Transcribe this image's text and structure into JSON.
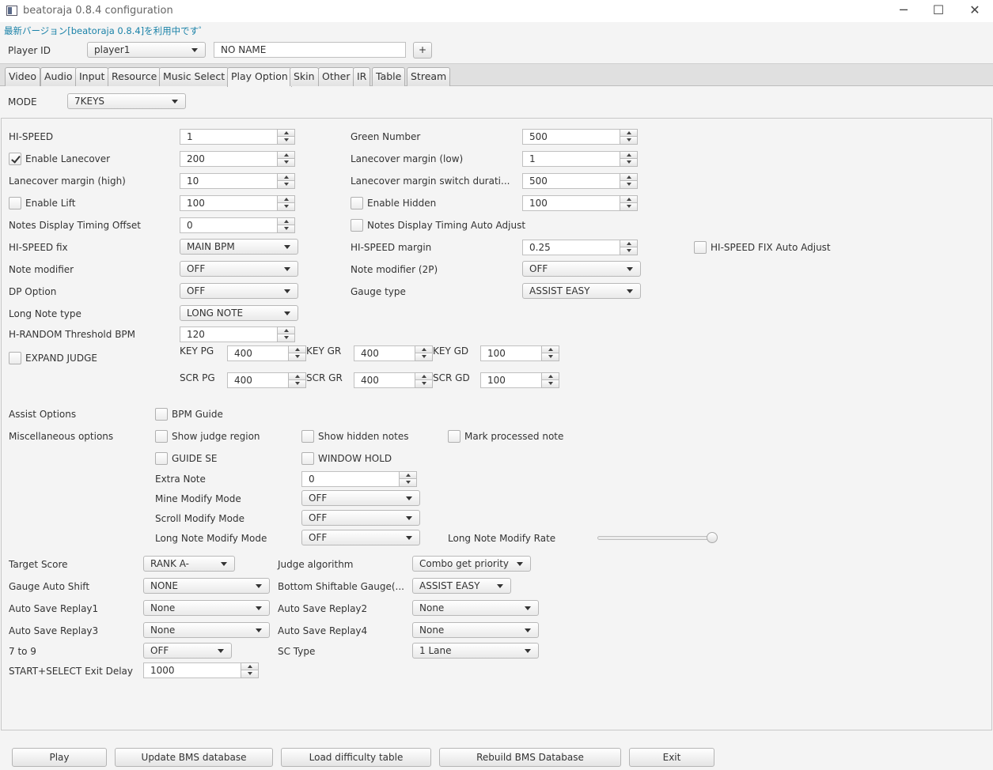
{
  "window": {
    "title": "beatoraja 0.8.4 configuration",
    "minimize_glyph": "─",
    "maximize_glyph": "☐",
    "close_glyph": "✕"
  },
  "update_message": "最新バージョン[beatoraja 0.8.4]を利用中です゜",
  "player": {
    "label": "Player ID",
    "selected": "player1",
    "name": "NO NAME",
    "add_label": "+"
  },
  "tabs": [
    {
      "label": "Video",
      "active": false
    },
    {
      "label": "Audio",
      "active": false
    },
    {
      "label": "Input",
      "active": false
    },
    {
      "label": "Resource",
      "active": false
    },
    {
      "label": "Music Select",
      "active": false
    },
    {
      "label": "Play Option",
      "active": true
    },
    {
      "label": "Skin",
      "active": false
    },
    {
      "label": "Other",
      "active": false
    },
    {
      "label": "IR",
      "active": false
    },
    {
      "label": "Table",
      "active": false
    },
    {
      "label": "Stream",
      "active": false
    }
  ],
  "mode": {
    "label": "MODE",
    "value": "7KEYS"
  },
  "options": {
    "hispeed": {
      "label": "HI-SPEED",
      "value": "1"
    },
    "green_number": {
      "label": "Green Number",
      "value": "500"
    },
    "enable_lanecover": {
      "label": "Enable Lanecover",
      "checked": true,
      "value": "200"
    },
    "lanecover_margin_low": {
      "label": "Lanecover margin (low)",
      "value": "1"
    },
    "lanecover_margin_high": {
      "label": "Lanecover margin (high)",
      "value": "10"
    },
    "lanecover_switch_duration": {
      "label": "Lanecover margin switch durati...",
      "value": "500"
    },
    "enable_lift": {
      "label": "Enable Lift",
      "checked": false,
      "value": "100"
    },
    "enable_hidden": {
      "label": "Enable Hidden",
      "checked": false,
      "value": "100"
    },
    "notes_timing_offset": {
      "label": "Notes Display Timing Offset",
      "value": "0"
    },
    "notes_timing_auto_adjust": {
      "label": "Notes Display Timing Auto Adjust",
      "checked": false
    },
    "hispeed_fix": {
      "label": "HI-SPEED fix",
      "value": "MAIN BPM"
    },
    "hispeed_margin": {
      "label": "HI-SPEED margin",
      "value": "0.25"
    },
    "hispeed_fix_auto_adjust": {
      "label": "HI-SPEED FIX Auto Adjust",
      "checked": false
    },
    "note_modifier": {
      "label": "Note modifier",
      "value": "OFF"
    },
    "note_modifier_2p": {
      "label": "Note modifier (2P)",
      "value": "OFF"
    },
    "dp_option": {
      "label": "DP Option",
      "value": "OFF"
    },
    "gauge_type": {
      "label": "Gauge type",
      "value": "ASSIST EASY"
    },
    "long_note_type": {
      "label": "Long Note type",
      "value": "LONG NOTE"
    },
    "hrandom_threshold": {
      "label": "H-RANDOM Threshold BPM",
      "value": "120"
    },
    "expand_judge": {
      "label": "EXPAND JUDGE",
      "checked": false
    }
  },
  "judge": {
    "key_pg": {
      "label": "KEY PG",
      "value": "400"
    },
    "key_gr": {
      "label": "KEY GR",
      "value": "400"
    },
    "key_gd": {
      "label": "KEY GD",
      "value": "100"
    },
    "scr_pg": {
      "label": "SCR PG",
      "value": "400"
    },
    "scr_gr": {
      "label": "SCR GR",
      "value": "400"
    },
    "scr_gd": {
      "label": "SCR GD",
      "value": "100"
    }
  },
  "assist": {
    "label": "Assist Options",
    "bpm_guide": {
      "label": "BPM Guide",
      "checked": false
    }
  },
  "misc": {
    "label": "Miscellaneous options",
    "show_judge_region": {
      "label": "Show judge region",
      "checked": false
    },
    "show_hidden_notes": {
      "label": "Show hidden notes",
      "checked": false
    },
    "mark_processed_note": {
      "label": "Mark processed note",
      "checked": false
    },
    "guide_se": {
      "label": "GUIDE SE",
      "checked": false
    },
    "window_hold": {
      "label": "WINDOW HOLD",
      "checked": false
    },
    "extra_note": {
      "label": "Extra Note",
      "value": "0"
    },
    "mine_modify_mode": {
      "label": "Mine Modify Mode",
      "value": "OFF"
    },
    "scroll_modify_mode": {
      "label": "Scroll Modify Mode",
      "value": "OFF"
    },
    "long_note_modify_mode": {
      "label": "Long Note Modify Mode",
      "value": "OFF"
    },
    "long_note_modify_rate": {
      "label": "Long Note Modify Rate",
      "fraction": 1.0
    }
  },
  "bottom": {
    "target_score": {
      "label": "Target Score",
      "value": "RANK A-"
    },
    "judge_algorithm": {
      "label": "Judge algorithm",
      "value": "Combo get priority"
    },
    "gauge_auto_shift": {
      "label": "Gauge Auto Shift",
      "value": "NONE"
    },
    "bottom_shiftable_gauge": {
      "label": "Bottom Shiftable Gauge(...",
      "value": "ASSIST EASY"
    },
    "auto_save_replay1": {
      "label": "Auto Save Replay1",
      "value": "None"
    },
    "auto_save_replay2": {
      "label": "Auto Save Replay2",
      "value": "None"
    },
    "auto_save_replay3": {
      "label": "Auto Save Replay3",
      "value": "None"
    },
    "auto_save_replay4": {
      "label": "Auto Save Replay4",
      "value": "None"
    },
    "seven_to_nine": {
      "label": "7 to 9",
      "value": "OFF"
    },
    "sc_type": {
      "label": "SC Type",
      "value": "1 Lane"
    },
    "start_select_exit_delay": {
      "label": "START+SELECT Exit Delay",
      "value": "1000"
    }
  },
  "actions": {
    "play": "Play",
    "update_db": "Update BMS database",
    "load_table": "Load difficulty table",
    "rebuild_db": "Rebuild BMS Database",
    "exit": "Exit"
  }
}
